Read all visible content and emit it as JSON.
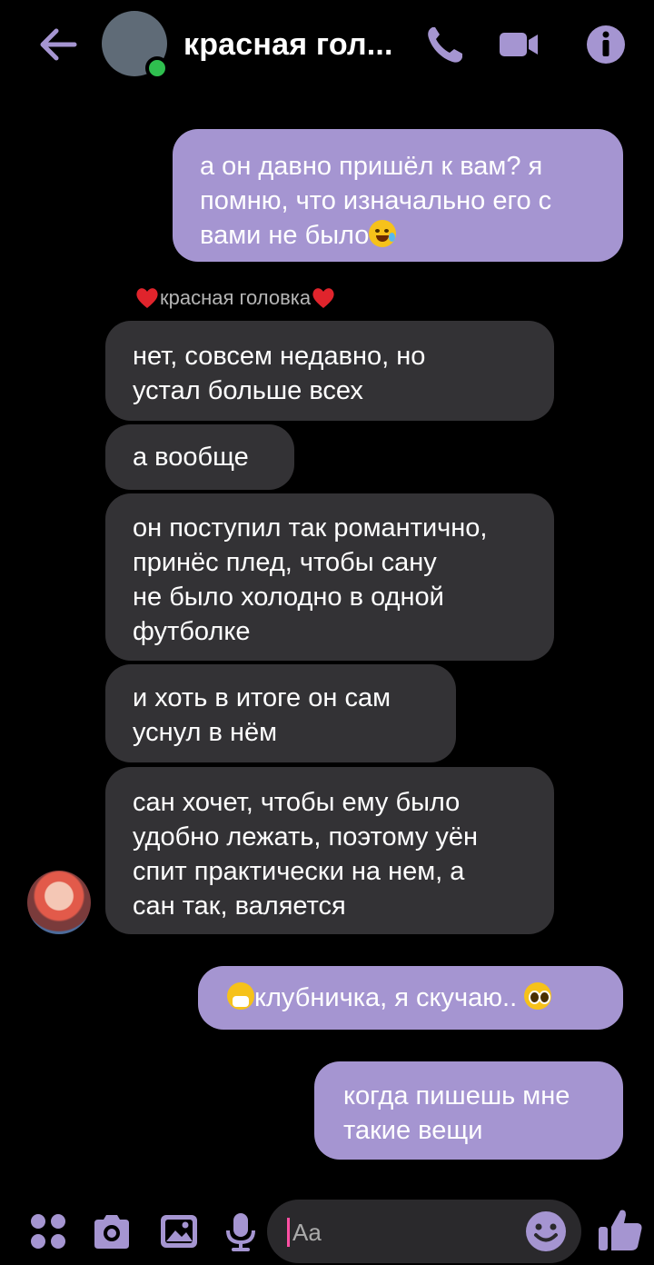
{
  "header": {
    "title": "красная гол...",
    "back_icon": "arrow-left-icon",
    "call_icon": "phone-icon",
    "video_icon": "video-camera-icon",
    "info_icon": "info-icon",
    "accent_color": "#a595d1",
    "online_color": "#2fbf4f"
  },
  "messages": {
    "m1": {
      "lines": [
        "а он давно пришёл к вам? я",
        "помню, что изначально его с",
        "вами не было"
      ],
      "emoji": "rolling-on-floor-laughing-emoji",
      "direction": "outgoing"
    },
    "sender_name": "красная головка",
    "m2": {
      "lines": [
        "нет, совсем недавно, но",
        "устал больше всех"
      ],
      "direction": "incoming"
    },
    "m3": {
      "lines": [
        "а вообще"
      ],
      "direction": "incoming"
    },
    "m4": {
      "lines": [
        "он поступил так романтично,",
        "принёс плед, чтобы сану",
        "не было холодно в одной",
        "футболке"
      ],
      "direction": "incoming"
    },
    "m5": {
      "lines": [
        "и хоть в итоге он сам",
        "уснул в нём"
      ],
      "direction": "incoming"
    },
    "m6": {
      "lines": [
        "сан хочет, чтобы ему было",
        "удобно лежать, поэтому уён",
        "спит практически на нем, а",
        "сан так, валяется"
      ],
      "direction": "incoming"
    },
    "m7": {
      "text": "клубничка, я скучаю..",
      "emoji_before": "sneezing-face-emoji",
      "emoji_after": "pleading-face-emoji",
      "direction": "outgoing"
    },
    "m8": {
      "lines": [
        "когда пишешь мне",
        "такие вещи"
      ],
      "direction": "outgoing"
    }
  },
  "composer": {
    "placeholder": "Aa",
    "icons": [
      "apps-icon",
      "camera-icon",
      "image-icon",
      "microphone-icon",
      "emoji-icon",
      "thumbs-up-icon"
    ]
  }
}
